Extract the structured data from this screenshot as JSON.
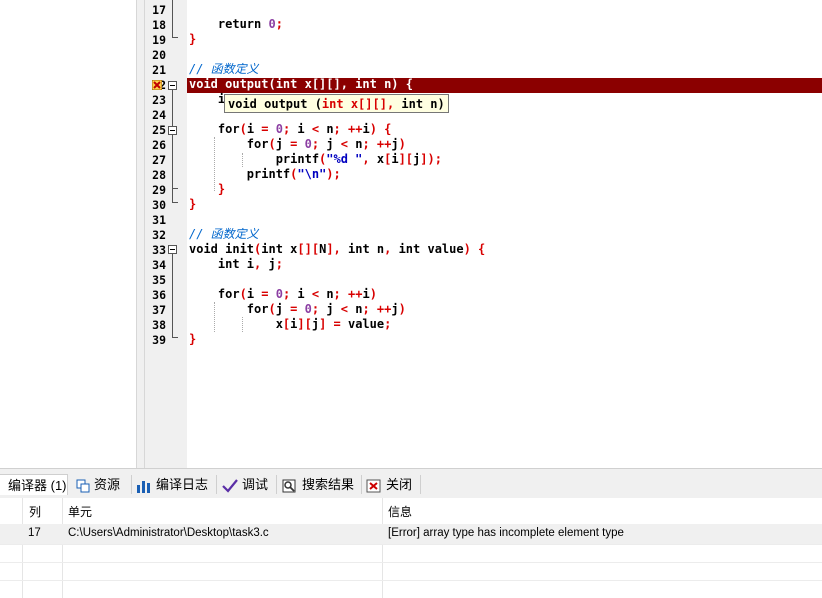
{
  "editor": {
    "lines": [
      {
        "num": "17",
        "tokens": []
      },
      {
        "num": "18",
        "tokens": [
          {
            "t": "    return ",
            "c": "kw"
          },
          {
            "t": "0",
            "c": "num"
          },
          {
            "t": ";",
            "c": "op"
          }
        ]
      },
      {
        "num": "19",
        "tokens": [
          {
            "t": "}",
            "c": "op"
          }
        ]
      },
      {
        "num": "20",
        "tokens": []
      },
      {
        "num": "21",
        "tokens": [
          {
            "t": "// 函数定义",
            "c": "cmt"
          }
        ]
      },
      {
        "num": "22",
        "tokens": [
          {
            "t": "void output(int x[][], int n) {",
            "c": "hl"
          }
        ]
      },
      {
        "num": "23",
        "tokens": [
          {
            "t": "    i",
            "c": "kw"
          }
        ]
      },
      {
        "num": "24",
        "tokens": []
      },
      {
        "num": "25",
        "tokens": [
          {
            "t": "    for",
            "c": "kw"
          },
          {
            "t": "(",
            "c": "op"
          },
          {
            "t": "i ",
            "c": "kw"
          },
          {
            "t": "= ",
            "c": "op"
          },
          {
            "t": "0",
            "c": "num"
          },
          {
            "t": "; ",
            "c": "op"
          },
          {
            "t": "i ",
            "c": "kw"
          },
          {
            "t": "< ",
            "c": "op"
          },
          {
            "t": "n",
            "c": "kw"
          },
          {
            "t": "; ++",
            "c": "op"
          },
          {
            "t": "i",
            "c": "kw"
          },
          {
            "t": ") {",
            "c": "op"
          }
        ]
      },
      {
        "num": "26",
        "tokens": [
          {
            "t": "        for",
            "c": "kw"
          },
          {
            "t": "(",
            "c": "op"
          },
          {
            "t": "j ",
            "c": "kw"
          },
          {
            "t": "= ",
            "c": "op"
          },
          {
            "t": "0",
            "c": "num"
          },
          {
            "t": "; ",
            "c": "op"
          },
          {
            "t": "j ",
            "c": "kw"
          },
          {
            "t": "< ",
            "c": "op"
          },
          {
            "t": "n",
            "c": "kw"
          },
          {
            "t": "; ++",
            "c": "op"
          },
          {
            "t": "j",
            "c": "kw"
          },
          {
            "t": ")",
            "c": "op"
          }
        ]
      },
      {
        "num": "27",
        "tokens": [
          {
            "t": "            printf",
            "c": "kw"
          },
          {
            "t": "(",
            "c": "op"
          },
          {
            "t": "\"%d \"",
            "c": "str"
          },
          {
            "t": ", ",
            "c": "op"
          },
          {
            "t": "x",
            "c": "kw"
          },
          {
            "t": "[",
            "c": "op"
          },
          {
            "t": "i",
            "c": "kw"
          },
          {
            "t": "][",
            "c": "op"
          },
          {
            "t": "j",
            "c": "kw"
          },
          {
            "t": "]);",
            "c": "op"
          }
        ]
      },
      {
        "num": "28",
        "tokens": [
          {
            "t": "        printf",
            "c": "kw"
          },
          {
            "t": "(",
            "c": "op"
          },
          {
            "t": "\"\\n\"",
            "c": "str"
          },
          {
            "t": ");",
            "c": "op"
          }
        ]
      },
      {
        "num": "29",
        "tokens": [
          {
            "t": "    }",
            "c": "op"
          }
        ]
      },
      {
        "num": "30",
        "tokens": [
          {
            "t": "}",
            "c": "op"
          }
        ]
      },
      {
        "num": "31",
        "tokens": []
      },
      {
        "num": "32",
        "tokens": [
          {
            "t": "// 函数定义",
            "c": "cmt"
          }
        ]
      },
      {
        "num": "33",
        "tokens": [
          {
            "t": "void init",
            "c": "kw"
          },
          {
            "t": "(",
            "c": "op"
          },
          {
            "t": "int x",
            "c": "kw"
          },
          {
            "t": "[][",
            "c": "op"
          },
          {
            "t": "N",
            "c": "kw"
          },
          {
            "t": "], ",
            "c": "op"
          },
          {
            "t": "int n",
            "c": "kw"
          },
          {
            "t": ", ",
            "c": "op"
          },
          {
            "t": "int value",
            "c": "kw"
          },
          {
            "t": ") {",
            "c": "op"
          }
        ]
      },
      {
        "num": "34",
        "tokens": [
          {
            "t": "    int i",
            "c": "kw"
          },
          {
            "t": ", ",
            "c": "op"
          },
          {
            "t": "j",
            "c": "kw"
          },
          {
            "t": ";",
            "c": "op"
          }
        ]
      },
      {
        "num": "35",
        "tokens": []
      },
      {
        "num": "36",
        "tokens": [
          {
            "t": "    for",
            "c": "kw"
          },
          {
            "t": "(",
            "c": "op"
          },
          {
            "t": "i ",
            "c": "kw"
          },
          {
            "t": "= ",
            "c": "op"
          },
          {
            "t": "0",
            "c": "num"
          },
          {
            "t": "; ",
            "c": "op"
          },
          {
            "t": "i ",
            "c": "kw"
          },
          {
            "t": "< ",
            "c": "op"
          },
          {
            "t": "n",
            "c": "kw"
          },
          {
            "t": "; ++",
            "c": "op"
          },
          {
            "t": "i",
            "c": "kw"
          },
          {
            "t": ")",
            "c": "op"
          }
        ]
      },
      {
        "num": "37",
        "tokens": [
          {
            "t": "        for",
            "c": "kw"
          },
          {
            "t": "(",
            "c": "op"
          },
          {
            "t": "j ",
            "c": "kw"
          },
          {
            "t": "= ",
            "c": "op"
          },
          {
            "t": "0",
            "c": "num"
          },
          {
            "t": "; ",
            "c": "op"
          },
          {
            "t": "j ",
            "c": "kw"
          },
          {
            "t": "< ",
            "c": "op"
          },
          {
            "t": "n",
            "c": "kw"
          },
          {
            "t": "; ++",
            "c": "op"
          },
          {
            "t": "j",
            "c": "kw"
          },
          {
            "t": ")",
            "c": "op"
          }
        ]
      },
      {
        "num": "38",
        "tokens": [
          {
            "t": "            x",
            "c": "kw"
          },
          {
            "t": "[",
            "c": "op"
          },
          {
            "t": "i",
            "c": "kw"
          },
          {
            "t": "][",
            "c": "op"
          },
          {
            "t": "j",
            "c": "kw"
          },
          {
            "t": "] = ",
            "c": "op"
          },
          {
            "t": "value",
            "c": "kw"
          },
          {
            "t": ";",
            "c": "op"
          }
        ]
      },
      {
        "num": "39",
        "tokens": [
          {
            "t": "}",
            "c": "op"
          }
        ]
      }
    ],
    "tooltip": [
      {
        "t": "void output (",
        "c": "kw"
      },
      {
        "t": "int x[][], ",
        "c": "op"
      },
      {
        "t": "int n)",
        "c": "kw"
      }
    ]
  },
  "tabs": {
    "compiler": "编译器 (1)",
    "resources": "资源",
    "compile_log": "编译日志",
    "debug": "调试",
    "search_results": "搜索结果",
    "close": "关闭"
  },
  "grid": {
    "headers": {
      "col": "列",
      "unit": "单元",
      "info": "信息"
    },
    "rows": [
      {
        "col": "17",
        "unit": "C:\\Users\\Administrator\\Desktop\\task3.c",
        "info": "[Error] array type has incomplete element type"
      }
    ]
  }
}
